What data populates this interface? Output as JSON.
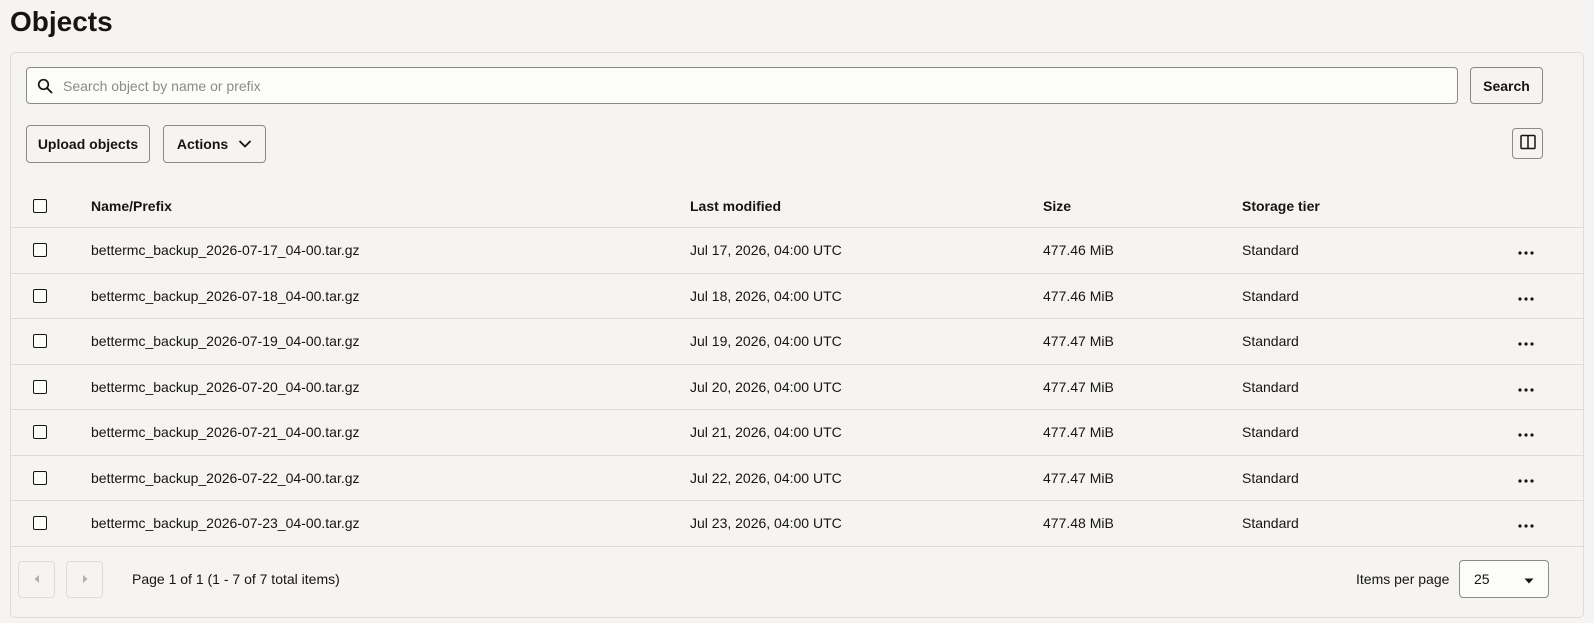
{
  "page": {
    "title": "Objects"
  },
  "search": {
    "placeholder": "Search object by name or prefix",
    "value": "",
    "button_label": "Search"
  },
  "toolbar": {
    "upload_label": "Upload objects",
    "actions_label": "Actions"
  },
  "table": {
    "columns": {
      "name": "Name/Prefix",
      "modified": "Last modified",
      "size": "Size",
      "tier": "Storage tier"
    },
    "rows": [
      {
        "name": "bettermc_backup_2026-07-17_04-00.tar.gz",
        "modified": "Jul 17, 2026, 04:00 UTC",
        "size": "477.46 MiB",
        "tier": "Standard"
      },
      {
        "name": "bettermc_backup_2026-07-18_04-00.tar.gz",
        "modified": "Jul 18, 2026, 04:00 UTC",
        "size": "477.46 MiB",
        "tier": "Standard"
      },
      {
        "name": "bettermc_backup_2026-07-19_04-00.tar.gz",
        "modified": "Jul 19, 2026, 04:00 UTC",
        "size": "477.47 MiB",
        "tier": "Standard"
      },
      {
        "name": "bettermc_backup_2026-07-20_04-00.tar.gz",
        "modified": "Jul 20, 2026, 04:00 UTC",
        "size": "477.47 MiB",
        "tier": "Standard"
      },
      {
        "name": "bettermc_backup_2026-07-21_04-00.tar.gz",
        "modified": "Jul 21, 2026, 04:00 UTC",
        "size": "477.47 MiB",
        "tier": "Standard"
      },
      {
        "name": "bettermc_backup_2026-07-22_04-00.tar.gz",
        "modified": "Jul 22, 2026, 04:00 UTC",
        "size": "477.47 MiB",
        "tier": "Standard"
      },
      {
        "name": "bettermc_backup_2026-07-23_04-00.tar.gz",
        "modified": "Jul 23, 2026, 04:00 UTC",
        "size": "477.48 MiB",
        "tier": "Standard"
      }
    ]
  },
  "pagination": {
    "summary": "Page 1 of 1 (1 - 7 of 7 total items)",
    "items_per_page_label": "Items per page",
    "items_per_page_value": "25"
  },
  "icons": {
    "search": "search-icon",
    "chevron": "chevron-down-icon",
    "panel": "split-panel-icon",
    "more": "more-horizontal-icon",
    "prev": "caret-left-icon",
    "next": "caret-right-icon",
    "caret": "caret-down-icon"
  },
  "colors": {
    "background": "#f5f4f2",
    "border": "#dedcd8",
    "text": "#161513",
    "muted": "#8d8b88"
  }
}
